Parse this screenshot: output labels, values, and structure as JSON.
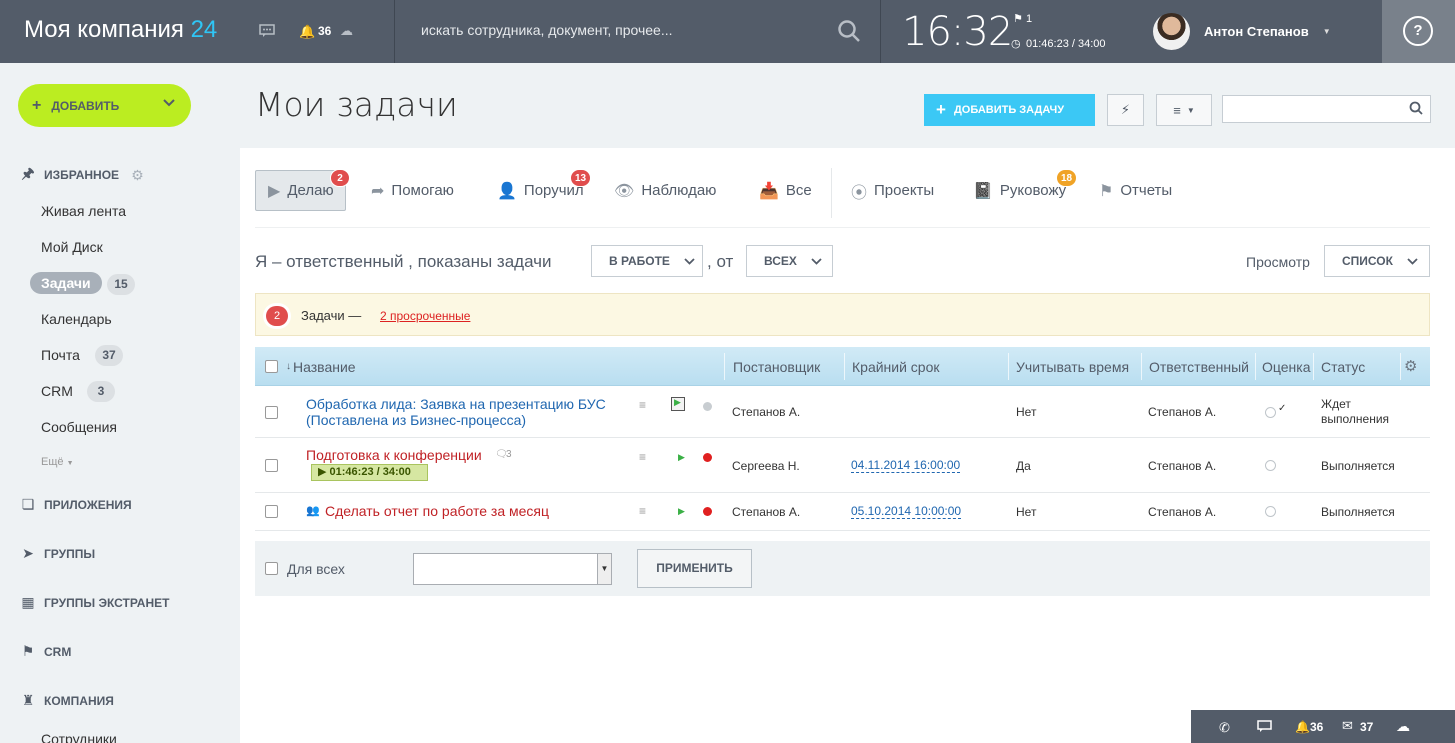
{
  "header": {
    "logo_name": "Моя компания",
    "logo_num": "24",
    "notifications_count": "36",
    "search_placeholder": "искать сотрудника, документ, прочее...",
    "clock": "16:32",
    "flag_count": "1",
    "worktime": "01:46:23 / 34:00",
    "user_name": "Антон Степанов",
    "help_label": "?"
  },
  "sidebar": {
    "add_label": "ДОБАВИТЬ",
    "favorites": "ИЗБРАННОЕ",
    "items": [
      {
        "label": "Живая лента"
      },
      {
        "label": "Мой Диск"
      },
      {
        "label": "Задачи",
        "count": "15"
      },
      {
        "label": "Календарь"
      },
      {
        "label": "Почта",
        "count": "37"
      },
      {
        "label": "CRM",
        "count": "3"
      },
      {
        "label": "Сообщения"
      }
    ],
    "more": "Ещё",
    "sections": [
      "ПРИЛОЖЕНИЯ",
      "ГРУППЫ",
      "ГРУППЫ ЭКСТРАНЕТ",
      "CRM",
      "КОМПАНИЯ"
    ],
    "last_item": "Сотрудники"
  },
  "page": {
    "title": "Мои задачи",
    "add_task": "ДОБАВИТЬ ЗАДАЧУ"
  },
  "tabs": [
    {
      "label": "Делаю",
      "badge": "2"
    },
    {
      "label": "Помогаю"
    },
    {
      "label": "Поручил",
      "badge": "13"
    },
    {
      "label": "Наблюдаю"
    },
    {
      "label": "Все"
    },
    {
      "label": "Проекты"
    },
    {
      "label": "Руковожу",
      "badge": "18"
    },
    {
      "label": "Отчеты"
    }
  ],
  "filter": {
    "text": "Я – ответственный , показаны задачи",
    "status": "В РАБОТЕ",
    "from": ", от",
    "who": "ВСЕХ",
    "view_label": "Просмотр",
    "view_value": "СПИСОК"
  },
  "notice": {
    "badge": "2",
    "text": "Задачи —",
    "link": "2 просроченные"
  },
  "table": {
    "headers": [
      "Название",
      "Постановщик",
      "Крайний срок",
      "Учитывать время",
      "Ответственный",
      "Оценка",
      "Статус"
    ],
    "rows": [
      {
        "name": "Обработка лида: Заявка на презентацию БУС (Поставлена из Бизнес-процесса)",
        "creator": "Степанов А.",
        "deadline": "",
        "track_time": "Нет",
        "responsible": "Степанов А.",
        "status": "Ждет выполнения"
      },
      {
        "name": "Подготовка к конференции",
        "comments": "3",
        "timer": "01:46:23 / 34:00",
        "creator": "Сергеева Н.",
        "deadline": "04.11.2014 16:00:00",
        "track_time": "Да",
        "responsible": "Степанов А.",
        "status": "Выполняется"
      },
      {
        "name": "Сделать отчет по работе за месяц",
        "creator": "Степанов А.",
        "deadline": "05.10.2014 10:00:00",
        "track_time": "Нет",
        "responsible": "Степанов А.",
        "status": "Выполняется"
      }
    ]
  },
  "footer": {
    "for_all": "Для всех",
    "apply": "ПРИМЕНИТЬ"
  },
  "bottombar": {
    "notifications": "36",
    "mail": "37"
  },
  "colors": {
    "topbar": "#535c69",
    "accent": "#2fc6f6",
    "add_button": "#bbed21",
    "add_task_button": "#3bc8f5",
    "overdue": "#c02226"
  }
}
